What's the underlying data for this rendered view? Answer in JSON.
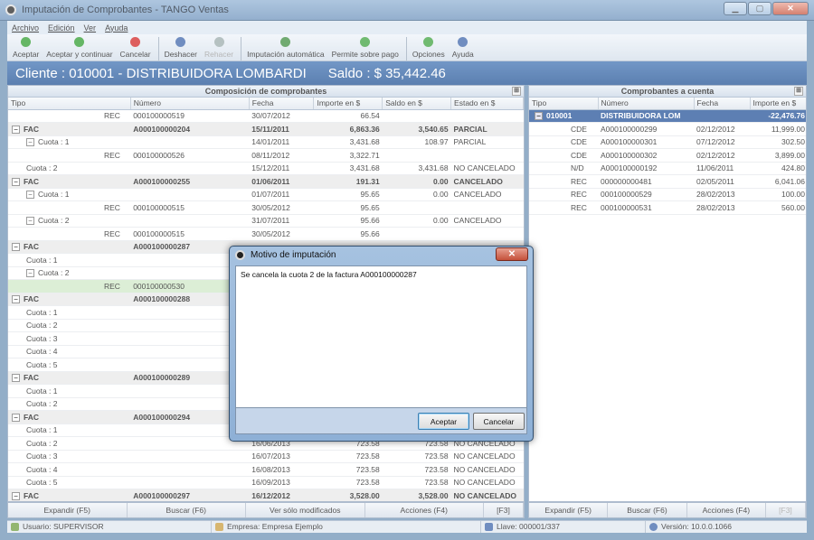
{
  "window": {
    "title": "Imputación de Comprobantes - TANGO Ventas"
  },
  "menu": [
    "Archivo",
    "Edición",
    "Ver",
    "Ayuda"
  ],
  "toolbar": [
    {
      "label": "Aceptar",
      "icon": "check-icon",
      "color": "#2a9a2a",
      "disabled": false
    },
    {
      "label": "Aceptar y continuar",
      "icon": "check-continue-icon",
      "color": "#2a9a2a",
      "disabled": false
    },
    {
      "label": "Cancelar",
      "icon": "cancel-icon",
      "color": "#d02020",
      "disabled": false
    },
    {
      "label": "Deshacer",
      "icon": "undo-icon",
      "color": "#3a62a8",
      "disabled": false
    },
    {
      "label": "Rehacer",
      "icon": "redo-icon",
      "color": "#9aa",
      "disabled": true
    },
    {
      "label": "Imputación automática",
      "icon": "auto-impute-icon",
      "color": "#3a8a3a",
      "disabled": false
    },
    {
      "label": "Permite sobre pago",
      "icon": "dollar-icon",
      "color": "#3aa03a",
      "disabled": false
    },
    {
      "label": "Opciones",
      "icon": "options-icon",
      "color": "#3aa03a",
      "disabled": false
    },
    {
      "label": "Ayuda",
      "icon": "help-icon",
      "color": "#3a62a8",
      "disabled": false
    }
  ],
  "header": {
    "cliente": "Cliente : 010001 - DISTRIBUIDORA LOMBARDI",
    "saldo": "Saldo : $  35,442.46"
  },
  "left_panel": {
    "title": "Composición de comprobantes",
    "columns": [
      "Tipo",
      "Número",
      "Fecha",
      "Importe en $",
      "Saldo en $",
      "Estado en $"
    ],
    "rows": [
      {
        "lvl": 2,
        "tipo": "REC",
        "numero": "000100000519",
        "fecha": "30/07/2012",
        "importe": "66.54",
        "saldo": "",
        "estado": "",
        "style": ""
      },
      {
        "lvl": 0,
        "tipo": "FAC",
        "numero": "A000100000204",
        "fecha": "15/11/2011",
        "importe": "6,863.36",
        "saldo": "3,540.65",
        "estado": "PARCIAL",
        "style": "grp",
        "tog": "−"
      },
      {
        "lvl": 1,
        "tipo": "Cuota : 1",
        "numero": "",
        "fecha": "14/01/2011",
        "importe": "3,431.68",
        "saldo": "108.97",
        "estado": "PARCIAL",
        "style": "",
        "tog": "−"
      },
      {
        "lvl": 2,
        "tipo": "REC",
        "numero": "000100000526",
        "fecha": "08/11/2012",
        "importe": "3,322.71",
        "saldo": "",
        "estado": "",
        "style": ""
      },
      {
        "lvl": 1,
        "tipo": "Cuota : 2",
        "numero": "",
        "fecha": "15/12/2011",
        "importe": "3,431.68",
        "saldo": "3,431.68",
        "estado": "NO CANCELADO",
        "style": ""
      },
      {
        "lvl": 0,
        "tipo": "FAC",
        "numero": "A000100000255",
        "fecha": "01/06/2011",
        "importe": "191.31",
        "saldo": "0.00",
        "estado": "CANCELADO",
        "style": "grp",
        "tog": "−"
      },
      {
        "lvl": 1,
        "tipo": "Cuota : 1",
        "numero": "",
        "fecha": "01/07/2011",
        "importe": "95.65",
        "saldo": "0.00",
        "estado": "CANCELADO",
        "style": "",
        "tog": "−"
      },
      {
        "lvl": 2,
        "tipo": "REC",
        "numero": "000100000515",
        "fecha": "30/05/2012",
        "importe": "95.65",
        "saldo": "",
        "estado": "",
        "style": ""
      },
      {
        "lvl": 1,
        "tipo": "Cuota : 2",
        "numero": "",
        "fecha": "31/07/2011",
        "importe": "95.66",
        "saldo": "0.00",
        "estado": "CANCELADO",
        "style": "",
        "tog": "−"
      },
      {
        "lvl": 2,
        "tipo": "REC",
        "numero": "000100000515",
        "fecha": "30/05/2012",
        "importe": "95.66",
        "saldo": "",
        "estado": "",
        "style": ""
      },
      {
        "lvl": 0,
        "tipo": "FAC",
        "numero": "A000100000287",
        "fecha": "",
        "importe": "",
        "saldo": "",
        "estado": "",
        "style": "grp",
        "tog": "−"
      },
      {
        "lvl": 1,
        "tipo": "Cuota : 1",
        "numero": "",
        "fecha": "",
        "importe": "",
        "saldo": "",
        "estado": "",
        "style": ""
      },
      {
        "lvl": 1,
        "tipo": "Cuota : 2",
        "numero": "",
        "fecha": "",
        "importe": "",
        "saldo": "",
        "estado": "",
        "style": "",
        "tog": "−"
      },
      {
        "lvl": 2,
        "tipo": "REC",
        "numero": "000100000530",
        "fecha": "",
        "importe": "",
        "saldo": "",
        "estado": "",
        "style": "sel"
      },
      {
        "lvl": 0,
        "tipo": "FAC",
        "numero": "A000100000288",
        "fecha": "",
        "importe": "",
        "saldo": "",
        "estado": "",
        "style": "grp",
        "tog": "−"
      },
      {
        "lvl": 1,
        "tipo": "Cuota : 1",
        "numero": "",
        "fecha": "",
        "importe": "",
        "saldo": "",
        "estado": "",
        "style": ""
      },
      {
        "lvl": 1,
        "tipo": "Cuota : 2",
        "numero": "",
        "fecha": "",
        "importe": "",
        "saldo": "",
        "estado": "",
        "style": ""
      },
      {
        "lvl": 1,
        "tipo": "Cuota : 3",
        "numero": "",
        "fecha": "",
        "importe": "",
        "saldo": "",
        "estado": "",
        "style": ""
      },
      {
        "lvl": 1,
        "tipo": "Cuota : 4",
        "numero": "",
        "fecha": "",
        "importe": "",
        "saldo": "",
        "estado": "",
        "style": ""
      },
      {
        "lvl": 1,
        "tipo": "Cuota : 5",
        "numero": "",
        "fecha": "",
        "importe": "",
        "saldo": "",
        "estado": "",
        "style": ""
      },
      {
        "lvl": 0,
        "tipo": "FAC",
        "numero": "A000100000289",
        "fecha": "",
        "importe": "",
        "saldo": "",
        "estado": "",
        "style": "grp",
        "tog": "−"
      },
      {
        "lvl": 1,
        "tipo": "Cuota : 1",
        "numero": "",
        "fecha": "",
        "importe": "",
        "saldo": "",
        "estado": "",
        "style": ""
      },
      {
        "lvl": 1,
        "tipo": "Cuota : 2",
        "numero": "",
        "fecha": "",
        "importe": "",
        "saldo": "",
        "estado": "",
        "style": ""
      },
      {
        "lvl": 0,
        "tipo": "FAC",
        "numero": "A000100000294",
        "fecha": "",
        "importe": "",
        "saldo": "",
        "estado": "",
        "style": "grp",
        "tog": "−"
      },
      {
        "lvl": 1,
        "tipo": "Cuota : 1",
        "numero": "",
        "fecha": "",
        "importe": "",
        "saldo": "",
        "estado": "",
        "style": ""
      },
      {
        "lvl": 1,
        "tipo": "Cuota : 2",
        "numero": "",
        "fecha": "16/06/2013",
        "importe": "723.58",
        "saldo": "723.58",
        "estado": "NO CANCELADO",
        "style": ""
      },
      {
        "lvl": 1,
        "tipo": "Cuota : 3",
        "numero": "",
        "fecha": "16/07/2013",
        "importe": "723.58",
        "saldo": "723.58",
        "estado": "NO CANCELADO",
        "style": ""
      },
      {
        "lvl": 1,
        "tipo": "Cuota : 4",
        "numero": "",
        "fecha": "16/08/2013",
        "importe": "723.58",
        "saldo": "723.58",
        "estado": "NO CANCELADO",
        "style": ""
      },
      {
        "lvl": 1,
        "tipo": "Cuota : 5",
        "numero": "",
        "fecha": "16/09/2013",
        "importe": "723.58",
        "saldo": "723.58",
        "estado": "NO CANCELADO",
        "style": ""
      },
      {
        "lvl": 0,
        "tipo": "FAC",
        "numero": "A000100000297",
        "fecha": "16/12/2012",
        "importe": "3,528.00",
        "saldo": "3,528.00",
        "estado": "NO CANCELADO",
        "style": "grp",
        "tog": "−"
      }
    ],
    "buttons": [
      "Expandir (F5)",
      "Buscar (F6)",
      "Ver sólo modificados",
      "Acciones (F4)",
      "[F3]"
    ]
  },
  "right_panel": {
    "title": "Comprobantes a cuenta",
    "columns": [
      "Tipo",
      "Número",
      "Fecha",
      "Importe en $"
    ],
    "client_row": {
      "codigo": "010001",
      "nombre": "DISTRIBUIDORA LOM",
      "importe": "-22,476.76"
    },
    "rows": [
      {
        "tipo": "CDE",
        "numero": "A000100000299",
        "fecha": "02/12/2012",
        "importe": "11,999.00"
      },
      {
        "tipo": "CDE",
        "numero": "A000100000301",
        "fecha": "07/12/2012",
        "importe": "302.50"
      },
      {
        "tipo": "CDE",
        "numero": "A000100000302",
        "fecha": "02/12/2012",
        "importe": "3,899.00"
      },
      {
        "tipo": "N/D",
        "numero": "A000100000192",
        "fecha": "11/06/2011",
        "importe": "424.80"
      },
      {
        "tipo": "REC",
        "numero": "000000000481",
        "fecha": "02/05/2011",
        "importe": "6,041.06"
      },
      {
        "tipo": "REC",
        "numero": "000100000529",
        "fecha": "28/02/2013",
        "importe": "100.00"
      },
      {
        "tipo": "REC",
        "numero": "000100000531",
        "fecha": "28/02/2013",
        "importe": "560.00"
      }
    ],
    "buttons": [
      "Expandir (F5)",
      "Buscar (F6)",
      "Acciones (F4)",
      "[F3]"
    ]
  },
  "status": {
    "usuario": "Usuario: SUPERVISOR",
    "empresa": "Empresa: Empresa Ejemplo",
    "llave": "Llave: 000001/337",
    "version": "Versión: 10.0.0.1066"
  },
  "dialog": {
    "title": "Motivo de imputación",
    "text": "Se cancela la cuota 2 de la factura A000100000287",
    "accept": "Aceptar",
    "cancel": "Cancelar"
  }
}
